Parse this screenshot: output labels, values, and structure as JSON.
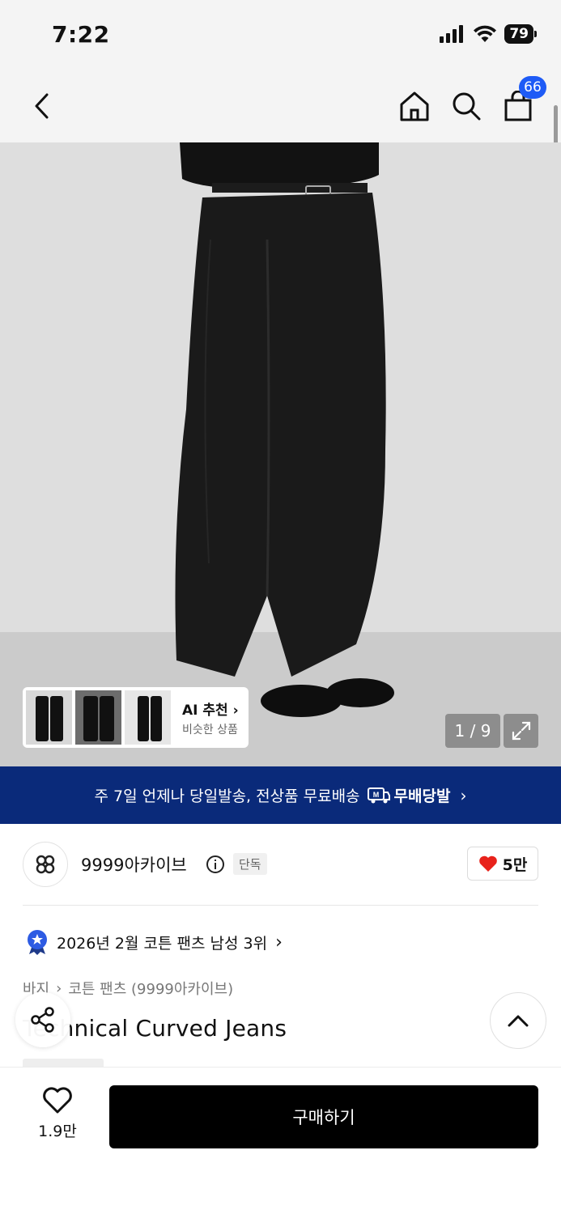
{
  "status_bar": {
    "time": "7:22",
    "battery": "79"
  },
  "header": {
    "cart_count": "66"
  },
  "gallery": {
    "counter": "1 / 9",
    "ai_title": "AI 추천",
    "ai_subtitle": "비슷한 상품"
  },
  "banner": {
    "text": "주 7일 언제나 당일발송, 전상품 무료배송",
    "brand": "무배당발"
  },
  "brand": {
    "name": "9999아카이브",
    "badge": "단독",
    "likes": "5만"
  },
  "ranking": {
    "text": "2026년 2월 코튼 팬츠 남성 3위"
  },
  "breadcrumb": {
    "category": "바지",
    "subcategory": "코튼 팬츠 (9999아카이브)"
  },
  "product": {
    "title": "Technical Curved Jeans"
  },
  "bottom_bar": {
    "wish_count": "1.9만",
    "buy_label": "구매하기"
  },
  "colors": {
    "banner_bg": "#0a2a7a",
    "badge_blue": "#1e5bf6",
    "heart_red": "#e8221b"
  }
}
